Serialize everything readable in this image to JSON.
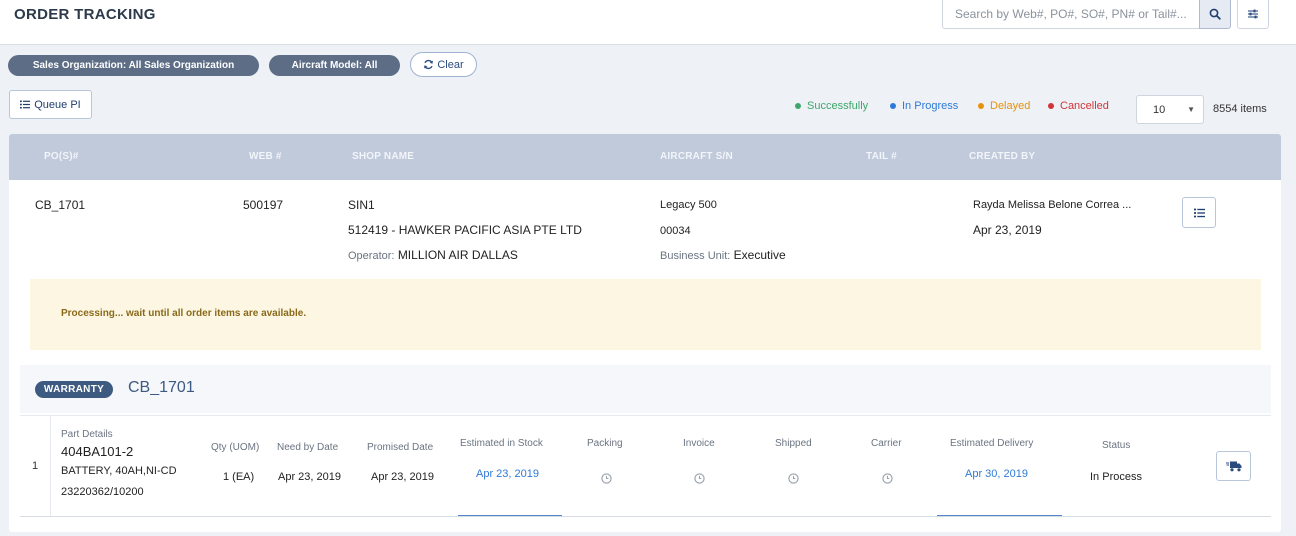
{
  "header": {
    "title": "ORDER TRACKING",
    "search_placeholder": "Search by Web#, PO#, SO#, PN# or Tail#..."
  },
  "filters": {
    "sales_org": "Sales Organization: All Sales Organization",
    "aircraft_model": "Aircraft Model: All",
    "clear_label": "Clear"
  },
  "toolbar": {
    "queue_label": "Queue PI",
    "legend": [
      {
        "label": "Successfully",
        "color": "#3fa66b"
      },
      {
        "label": "In Progress",
        "color": "#2f7ad8"
      },
      {
        "label": "Delayed",
        "color": "#e6930c"
      },
      {
        "label": "Cancelled",
        "color": "#d0353a"
      }
    ],
    "page_size": "10",
    "item_count": "8554 items"
  },
  "table": {
    "columns": [
      "PO(S)#",
      "WEB #",
      "SHOP NAME",
      "AIRCRAFT S/N",
      "TAIL #",
      "CREATED BY"
    ]
  },
  "order": {
    "po": "CB_1701",
    "web": "500197",
    "shop_name": "SIN1",
    "shop_company": "512419 - HAWKER PACIFIC ASIA PTE LTD",
    "operator_label": "Operator:",
    "operator_value": "MILLION AIR DALLAS",
    "aircraft_model": "Legacy 500",
    "aircraft_sn": "00034",
    "business_unit_label": "Business Unit:",
    "business_unit_value": "Executive",
    "created_by": "Rayda Melissa Belone Correa ...",
    "created_date": "Apr 23, 2019",
    "notice": "Processing... wait until all order items are available.",
    "warranty_badge": "WARRANTY",
    "warranty_id": "CB_1701"
  },
  "line_item": {
    "number": "1",
    "part_details_label": "Part Details",
    "part_number": "404BA101-2",
    "part_desc": "BATTERY, 40AH,NI-CD",
    "part_ref": "23220362/10200",
    "qty_label": "Qty (UOM)",
    "qty_value": "1 (EA)",
    "need_by_label": "Need by Date",
    "need_by_value": "Apr 23, 2019",
    "promised_label": "Promised Date",
    "promised_value": "Apr 23, 2019",
    "est_stock_label": "Estimated in Stock",
    "est_stock_value": "Apr 23, 2019",
    "packing_label": "Packing",
    "invoice_label": "Invoice",
    "shipped_label": "Shipped",
    "carrier_label": "Carrier",
    "est_delivery_label": "Estimated Delivery",
    "est_delivery_value": "Apr 30, 2019",
    "status_label": "Status",
    "status_value": "In Process"
  }
}
